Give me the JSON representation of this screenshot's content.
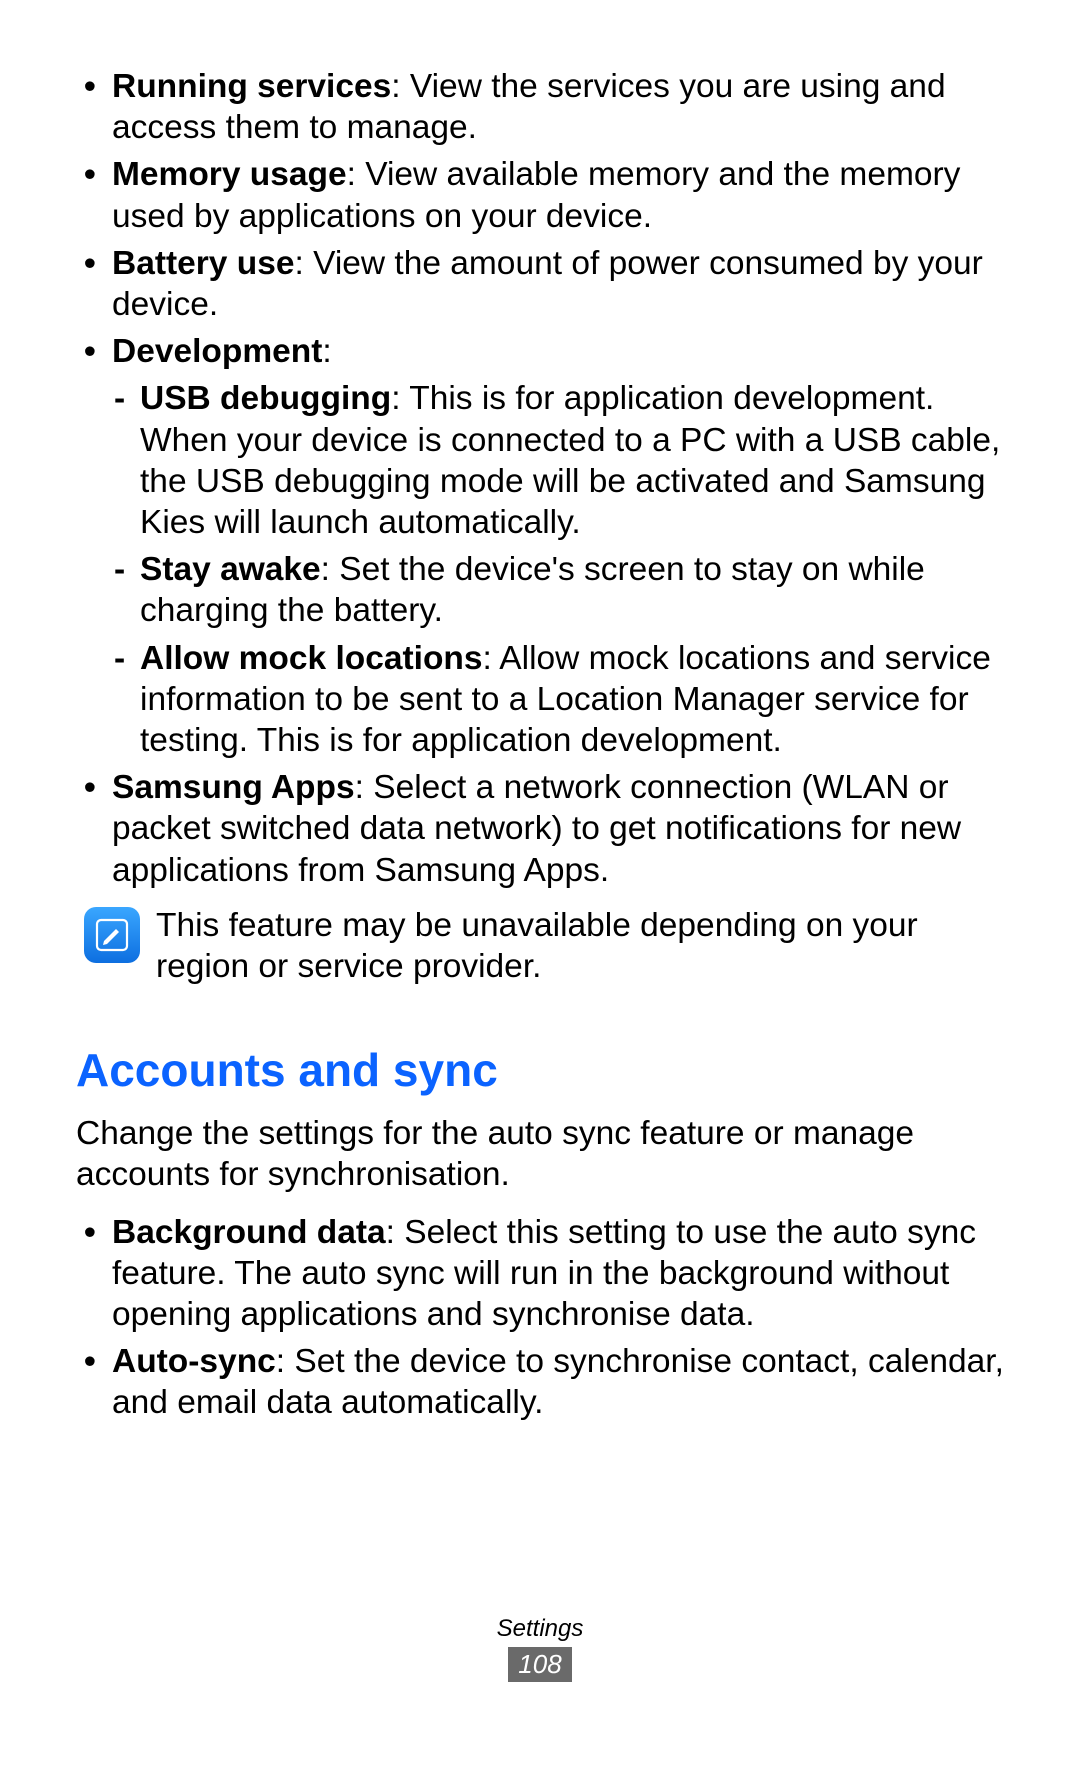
{
  "topBullets": [
    {
      "title": "Running services",
      "desc": ": View the services you are using and access them to manage."
    },
    {
      "title": "Memory usage",
      "desc": ": View available memory and the memory used by applications on your device."
    },
    {
      "title": "Battery use",
      "desc": ": View the amount of power consumed by your device."
    },
    {
      "title": "Development",
      "desc": ":",
      "sub": [
        {
          "title": "USB debugging",
          "desc": ": This is for application development. When your device is connected to a PC with a USB cable, the USB debugging mode will be activated and Samsung Kies will launch automatically."
        },
        {
          "title": "Stay awake",
          "desc": ": Set the device's screen to stay on while charging the battery."
        },
        {
          "title": "Allow mock locations",
          "desc": ": Allow mock locations and service information to be sent to a Location Manager service for testing. This is for application development."
        }
      ]
    },
    {
      "title": "Samsung Apps",
      "desc": ": Select a network connection (WLAN or packet switched data network) to get notifications for new applications from Samsung Apps."
    }
  ],
  "note": "This feature may be unavailable depending on your region or service provider.",
  "section": {
    "heading": "Accounts and sync",
    "intro": "Change the settings for the auto sync feature or manage accounts for synchronisation.",
    "bullets": [
      {
        "title": "Background data",
        "desc": ": Select this setting to use the auto sync feature. The auto sync will run in the background without opening applications and synchronise data."
      },
      {
        "title": "Auto-sync",
        "desc": ": Set the device to synchronise contact, calendar, and email data automatically."
      }
    ]
  },
  "footer": {
    "section": "Settings",
    "page": "108"
  }
}
